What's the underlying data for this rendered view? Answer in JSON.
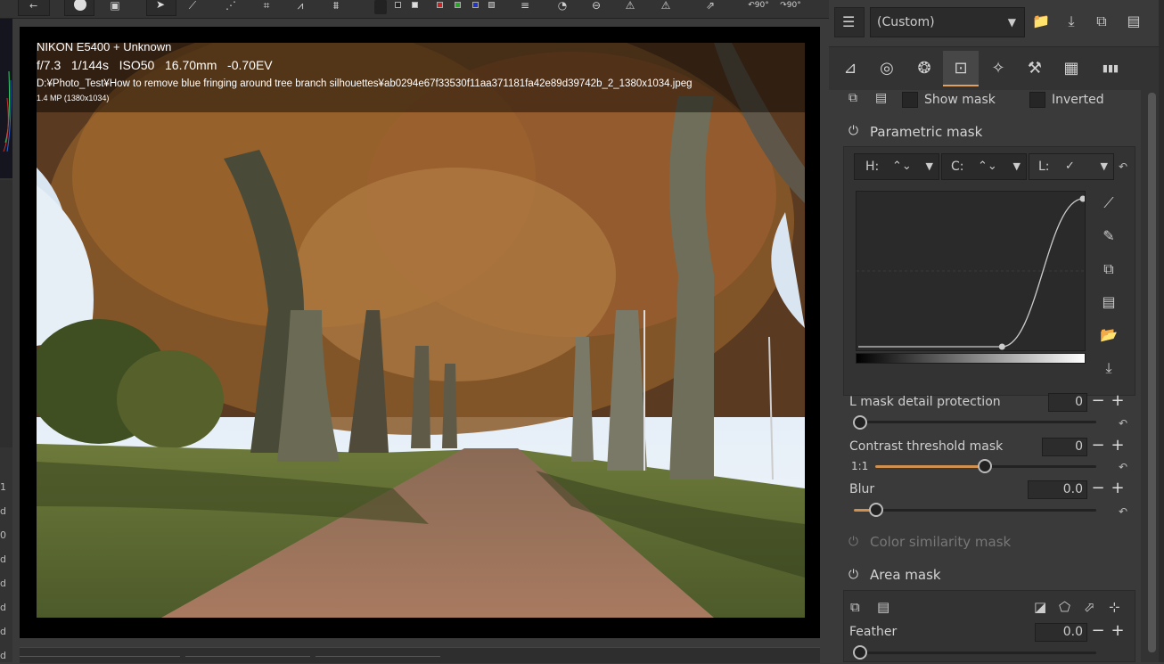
{
  "photo_info": {
    "camera": "NIKON E5400 + Unknown",
    "aperture": "f/7.3",
    "shutter": "1/144s",
    "iso": "ISO50",
    "focal": "16.70mm",
    "ev": "-0.70EV",
    "path": "D:¥Photo_Test¥How to remove blue fringing around tree branch silhouettes¥ab0294e67f33530f11aa371181fa42e89d39742b_2_1380x1034.jpeg",
    "resolution": "1.4 MP (1380x1034)"
  },
  "profile": {
    "selected": "(Custom)"
  },
  "mask_options": {
    "show_mask_label": "Show mask",
    "inverted_label": "Inverted"
  },
  "parametric_mask": {
    "title": "Parametric mask",
    "channels": [
      {
        "label": "H:"
      },
      {
        "label": "C:"
      },
      {
        "label": "L:"
      }
    ]
  },
  "sliders": {
    "l_mask_detail": {
      "label": "L mask detail protection",
      "value": "0"
    },
    "contrast_threshold": {
      "label": "Contrast threshold mask",
      "value": "0",
      "sublabel": "1:1"
    },
    "blur": {
      "label": "Blur",
      "value": "0.0"
    },
    "feather": {
      "label": "Feather",
      "value": "0.0"
    }
  },
  "sections": {
    "color_similarity": "Color similarity mask",
    "area_mask": "Area mask"
  },
  "left_strip_numbers": [
    "1",
    "d",
    "0",
    "d",
    "d",
    "d",
    "d",
    "d"
  ],
  "accent_color": "#e0a060",
  "curve_points": [
    [
      0,
      0
    ],
    [
      0.64,
      0
    ],
    [
      1,
      1
    ]
  ]
}
